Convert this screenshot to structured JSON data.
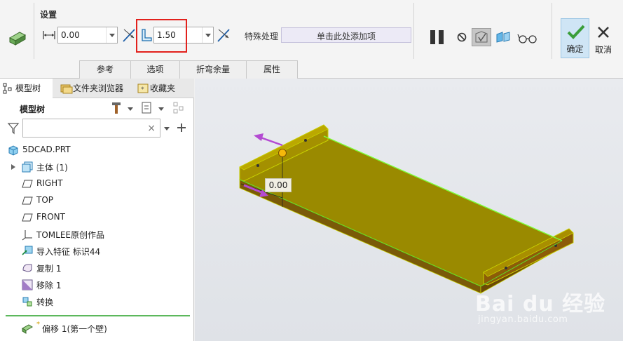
{
  "ribbon": {
    "group_title": "设置",
    "length_value": "0.00",
    "thickness_value": "1.50",
    "special_label": "特殊处理",
    "special_placeholder": "单击此处添加项",
    "ok_label": "确定",
    "cancel_label": "取消",
    "tabs": [
      "参考",
      "选项",
      "折弯余量",
      "属性"
    ],
    "highlight_color": "#e2211c"
  },
  "panel": {
    "nav_tabs": [
      "模型树",
      "文件夹浏览器",
      "收藏夹"
    ],
    "tree_title": "模型树",
    "filter_placeholder": "",
    "root": "5DCAD.PRT",
    "items": [
      {
        "label": "主体 (1)",
        "icon": "body-icon"
      },
      {
        "label": "RIGHT",
        "icon": "datum-plane-icon"
      },
      {
        "label": "TOP",
        "icon": "datum-plane-icon"
      },
      {
        "label": "FRONT",
        "icon": "datum-plane-icon"
      },
      {
        "label": "TOMLEE原创作品",
        "icon": "coordinate-system-icon"
      },
      {
        "label": "导入特征 标识44",
        "icon": "import-feature-icon"
      },
      {
        "label": "复制 1",
        "icon": "copy-feature-icon"
      },
      {
        "label": "移除 1",
        "icon": "remove-feature-icon"
      },
      {
        "label": "转换",
        "icon": "convert-feature-icon"
      }
    ],
    "insert_item": "偏移 1(第一个壁)"
  },
  "graphics": {
    "dimension_value": "0.00",
    "model_color": "#9a8a00",
    "watermark_main": "Bai du 经验",
    "watermark_sub": "jingyan.baidu.com"
  }
}
